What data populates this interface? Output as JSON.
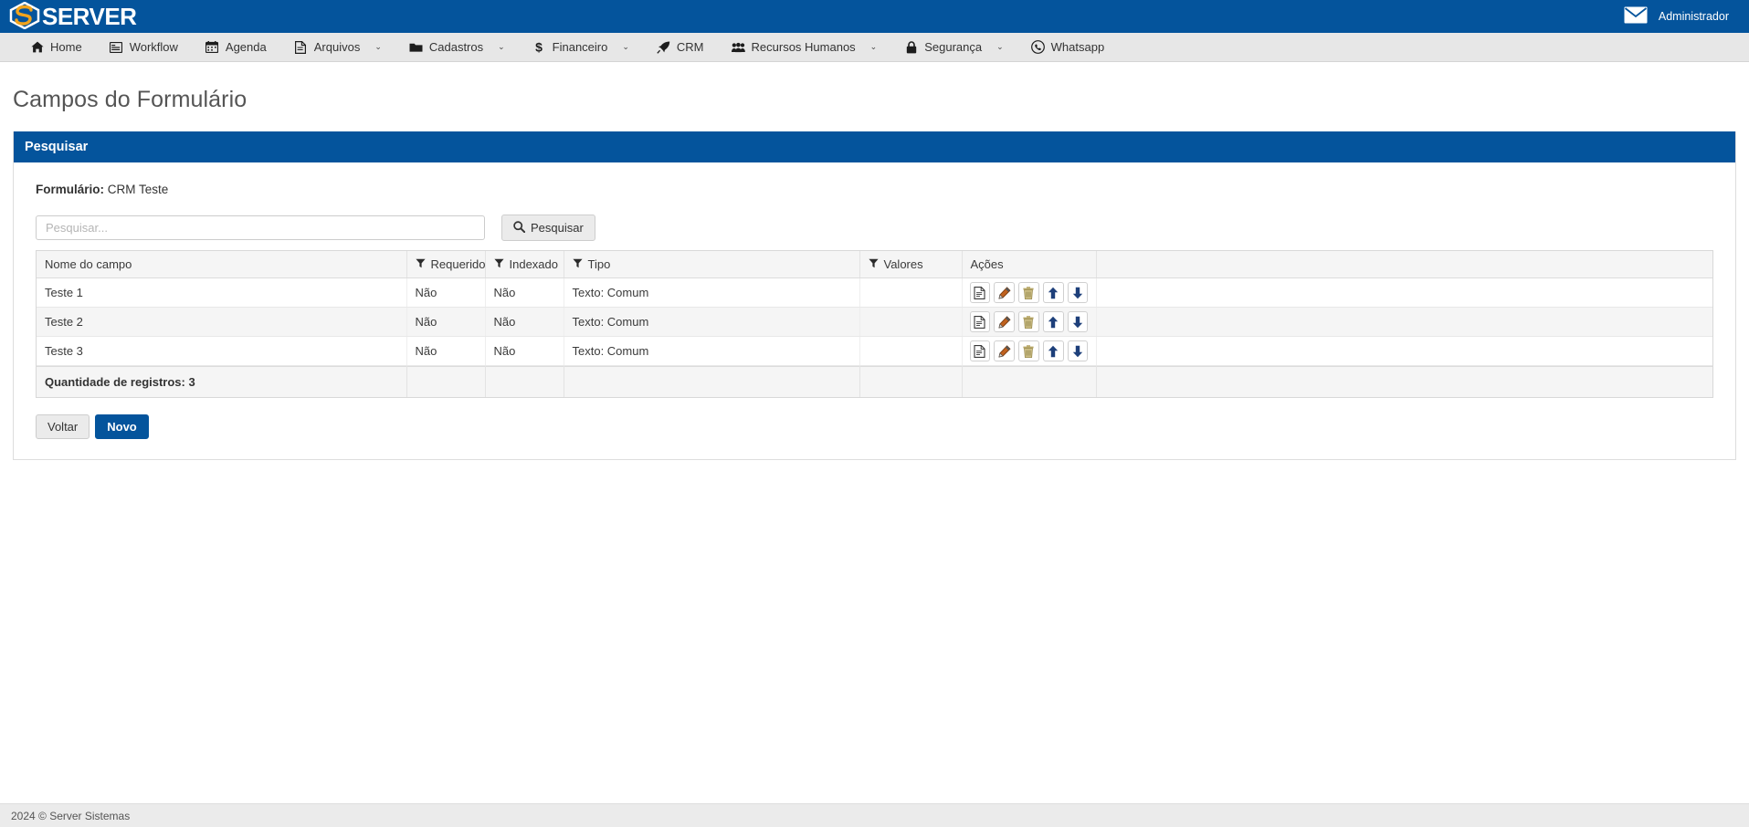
{
  "brand": {
    "name": "SERVER",
    "logo_icon": "server-hexagon-logo",
    "bar_color": "#04549c"
  },
  "topbar": {
    "mail_icon": "envelope-icon",
    "user_label": "Administrador"
  },
  "nav": {
    "items": [
      {
        "label": "Home",
        "icon": "home-icon",
        "caret": false
      },
      {
        "label": "Workflow",
        "icon": "workflow-icon",
        "caret": false
      },
      {
        "label": "Agenda",
        "icon": "calendar-icon",
        "caret": false
      },
      {
        "label": "Arquivos",
        "icon": "file-icon",
        "caret": true
      },
      {
        "label": "Cadastros",
        "icon": "folder-icon",
        "caret": true
      },
      {
        "label": "Financeiro",
        "icon": "dollar-icon",
        "caret": true
      },
      {
        "label": "CRM",
        "icon": "rocket-icon",
        "caret": false
      },
      {
        "label": "Recursos Humanos",
        "icon": "users-icon",
        "caret": true
      },
      {
        "label": "Segurança",
        "icon": "lock-icon",
        "caret": true
      },
      {
        "label": "Whatsapp",
        "icon": "whatsapp-icon",
        "caret": false
      }
    ],
    "caret_glyph": "⌄"
  },
  "page": {
    "title": "Campos do Formulário"
  },
  "panel": {
    "header": "Pesquisar",
    "form_label": "Formulário:",
    "form_value": "CRM Teste"
  },
  "search": {
    "placeholder": "Pesquisar...",
    "value": "",
    "button_label": "Pesquisar",
    "button_icon": "search-icon"
  },
  "grid": {
    "columns": [
      {
        "label": "Nome do campo",
        "filter": false
      },
      {
        "label": "Requerido",
        "filter": true
      },
      {
        "label": "Indexado",
        "filter": true
      },
      {
        "label": "Tipo",
        "filter": true
      },
      {
        "label": "Valores",
        "filter": true
      },
      {
        "label": "Ações",
        "filter": false
      },
      {
        "label": "",
        "filter": false
      }
    ],
    "rows": [
      {
        "nome": "Teste 1",
        "requerido": "Não",
        "indexado": "Não",
        "tipo": "Texto: Comum",
        "valores": ""
      },
      {
        "nome": "Teste 2",
        "requerido": "Não",
        "indexado": "Não",
        "tipo": "Texto: Comum",
        "valores": ""
      },
      {
        "nome": "Teste 3",
        "requerido": "Não",
        "indexado": "Não",
        "tipo": "Texto: Comum",
        "valores": ""
      }
    ],
    "row_actions": [
      {
        "name": "view-document-action",
        "icon": "document-icon"
      },
      {
        "name": "edit-action",
        "icon": "pencil-icon"
      },
      {
        "name": "delete-action",
        "icon": "trash-icon"
      },
      {
        "name": "move-up-action",
        "icon": "arrow-up-icon"
      },
      {
        "name": "move-down-action",
        "icon": "arrow-down-icon"
      }
    ],
    "footer_total": "Quantidade de registros: 3",
    "scrollbar": "vertical-scrollbar"
  },
  "bottom_buttons": [
    {
      "label": "Voltar",
      "style": "default",
      "name": "back-button"
    },
    {
      "label": "Novo",
      "style": "primary",
      "name": "new-button"
    }
  ],
  "footer": {
    "text": "2024 © Server Sistemas"
  },
  "colors": {
    "brand_blue": "#04549c",
    "nav_bg": "#e7e7e7",
    "panel_header": "#04549c",
    "pencil_icon": "#c0621f",
    "trash_icon": "#b9a96a",
    "arrow_icon": "#1d3f7a"
  }
}
